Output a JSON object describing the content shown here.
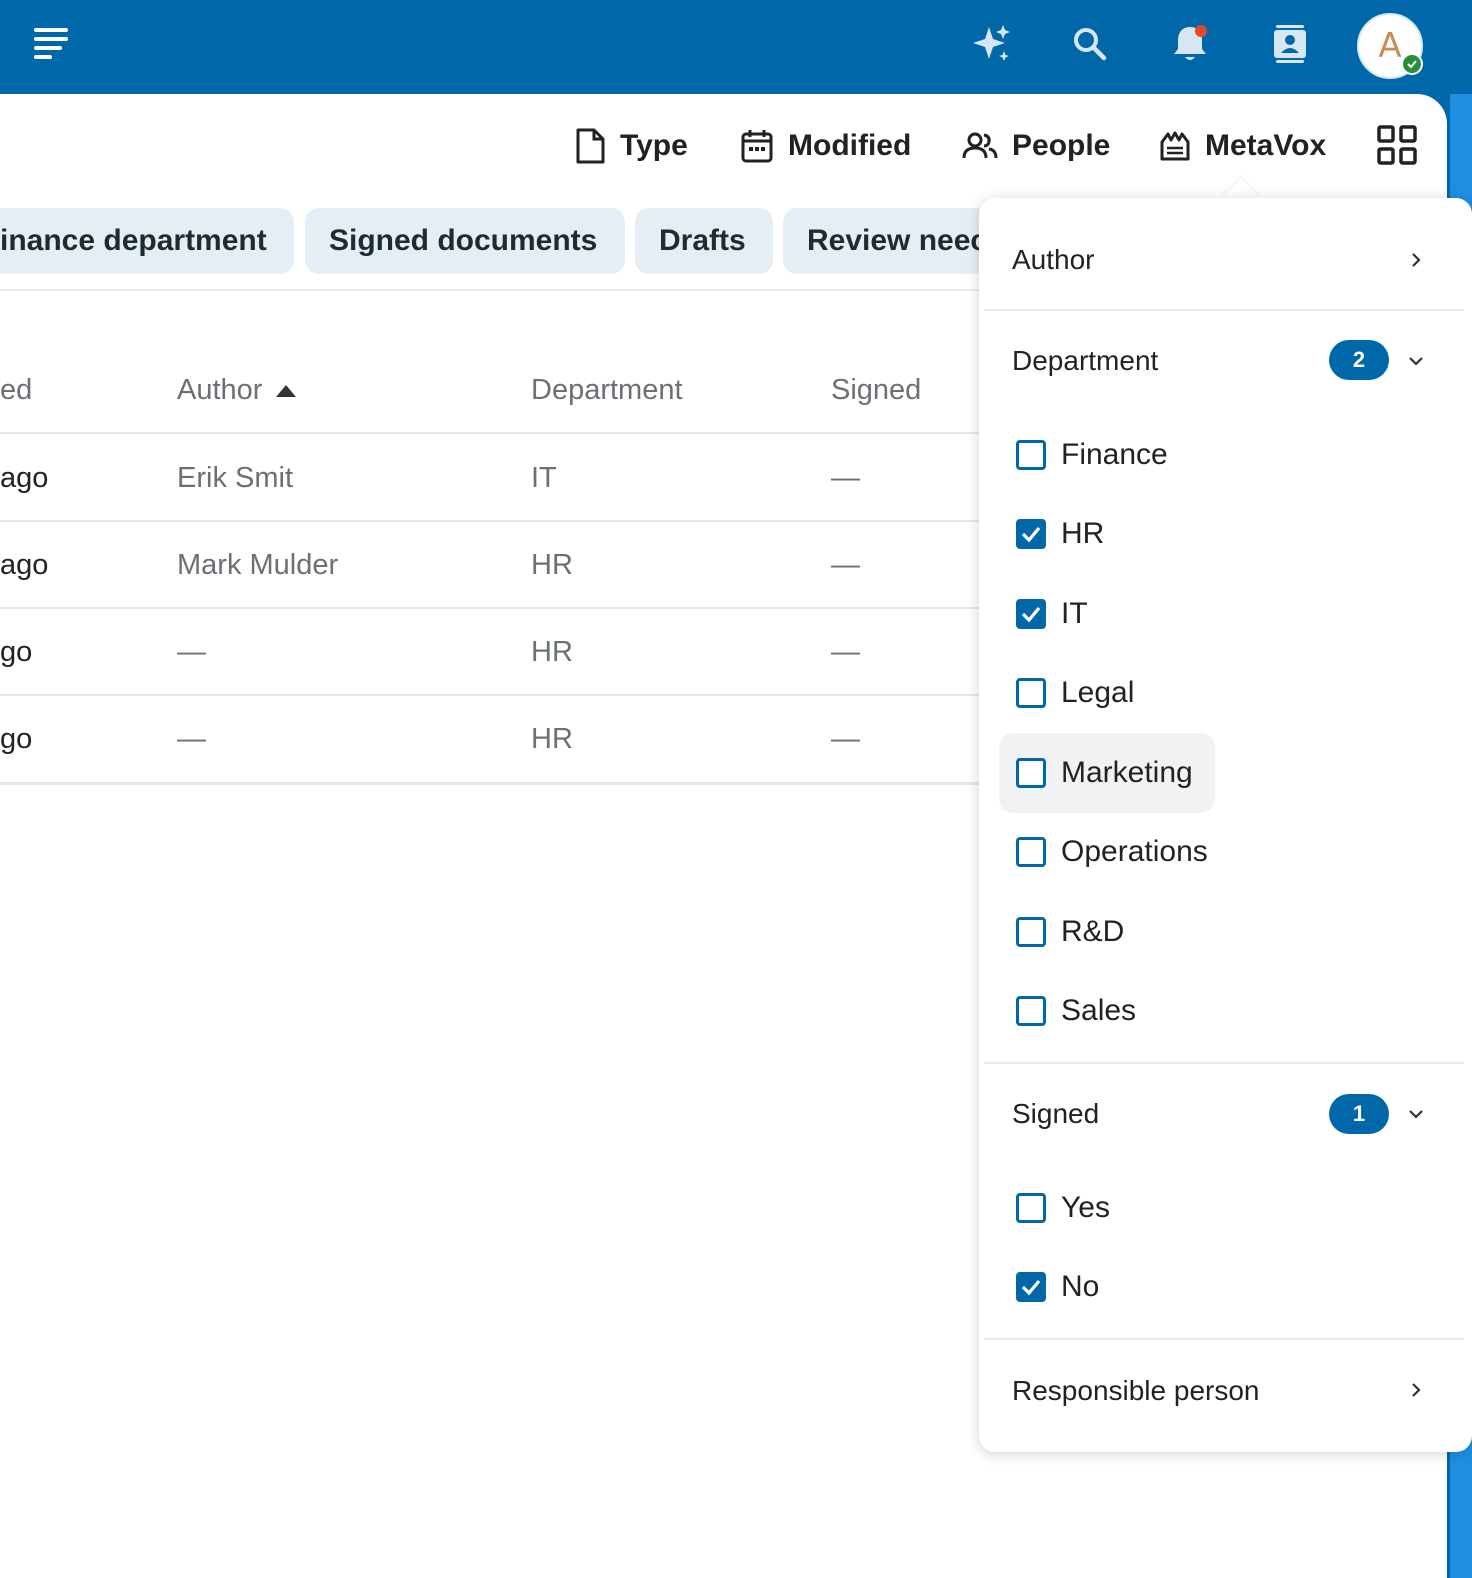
{
  "header": {
    "menu_icon": "menu-icon",
    "icons": [
      "sparkle-icon",
      "search-icon",
      "bell-icon",
      "contacts-icon"
    ],
    "avatar_letter": "A"
  },
  "toolbar": {
    "filters": [
      {
        "label": "Type",
        "icon": "document-icon"
      },
      {
        "label": "Modified",
        "icon": "calendar-icon"
      },
      {
        "label": "People",
        "icon": "people-icon"
      },
      {
        "label": "MetaVox",
        "icon": "metavox-icon"
      }
    ],
    "view_icon": "grid-view-icon"
  },
  "chips": [
    "inance department",
    "Signed documents",
    "Drafts",
    "Review neec"
  ],
  "table": {
    "columns": [
      "ed",
      "Author",
      "Department",
      "Signed"
    ],
    "sort": {
      "column": "Author",
      "direction": "ascending"
    },
    "rows": [
      {
        "modified": " ago",
        "author": "Erik Smit",
        "department": "IT",
        "signed": "—"
      },
      {
        "modified": " ago",
        "author": "Mark Mulder",
        "department": "HR",
        "signed": "—"
      },
      {
        "modified": "go",
        "author": "—",
        "department": "HR",
        "signed": "—"
      },
      {
        "modified": "go",
        "author": "—",
        "department": "HR",
        "signed": "—"
      }
    ]
  },
  "dropdown": {
    "author_label": "Author",
    "department": {
      "label": "Department",
      "count": "2",
      "options": [
        {
          "label": "Finance",
          "checked": false
        },
        {
          "label": "HR",
          "checked": true
        },
        {
          "label": "IT",
          "checked": true
        },
        {
          "label": "Legal",
          "checked": false
        },
        {
          "label": "Marketing",
          "checked": false
        },
        {
          "label": "Operations",
          "checked": false
        },
        {
          "label": "R&D",
          "checked": false
        },
        {
          "label": "Sales",
          "checked": false
        }
      ]
    },
    "signed": {
      "label": "Signed",
      "count": "1",
      "options": [
        {
          "label": "Yes",
          "checked": false
        },
        {
          "label": "No",
          "checked": true
        }
      ]
    },
    "responsible_label": "Responsible person"
  },
  "colors": {
    "brand": "#0068a8",
    "chip_bg": "#e6eef5",
    "notification_dot": "#e9462f",
    "status_online": "#2a8f3c"
  }
}
